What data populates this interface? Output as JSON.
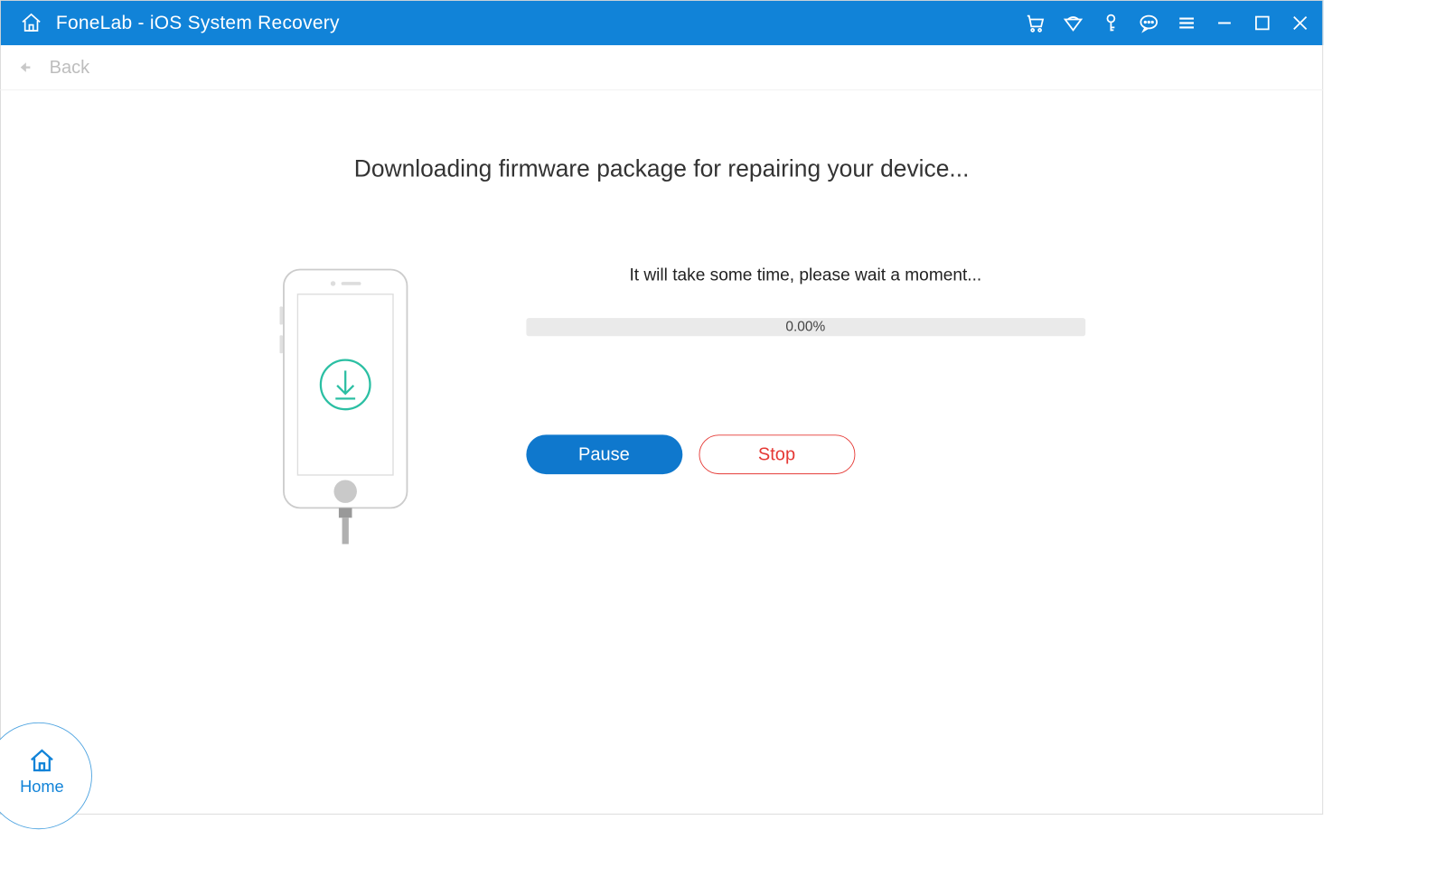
{
  "titlebar": {
    "title": "FoneLab - iOS System Recovery"
  },
  "back": {
    "label": "Back"
  },
  "main": {
    "heading": "Downloading firmware package for repairing your device...",
    "wait_text": "It will take some time, please wait a moment...",
    "progress_percent": "0.00%",
    "pause_label": "Pause",
    "stop_label": "Stop"
  },
  "home": {
    "label": "Home"
  },
  "colors": {
    "primary": "#1183d8",
    "danger": "#e53935",
    "download_icon": "#2bbfa3"
  }
}
